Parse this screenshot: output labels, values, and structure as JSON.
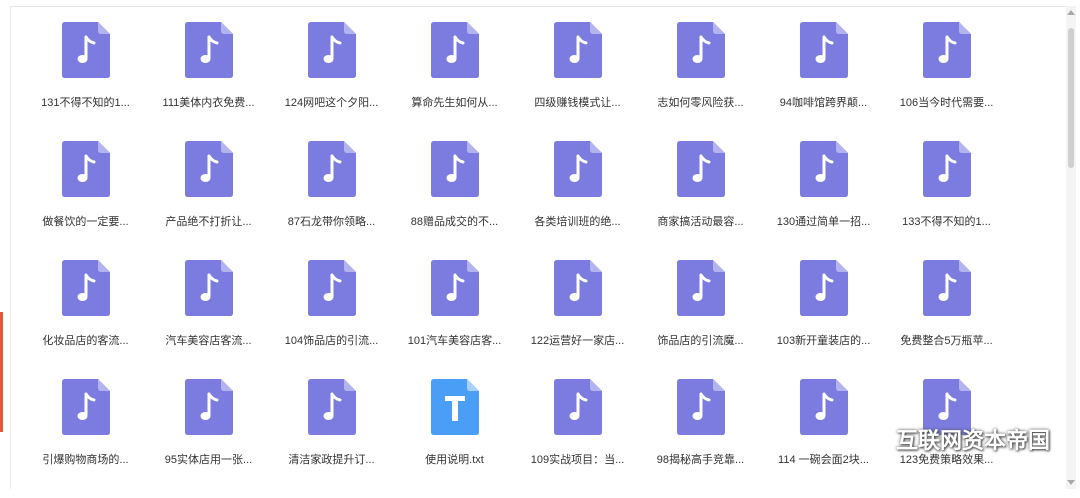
{
  "colors": {
    "audio_icon": "#7b7be0",
    "text_icon": "#4a9ef5",
    "fold": "#b3b3f0"
  },
  "files": [
    {
      "name": "131不得不知的1...",
      "type": "audio"
    },
    {
      "name": "111美体内衣免费...",
      "type": "audio"
    },
    {
      "name": "124网吧这个夕阳...",
      "type": "audio"
    },
    {
      "name": "算命先生如何从...",
      "type": "audio"
    },
    {
      "name": "四级赚钱模式让...",
      "type": "audio"
    },
    {
      "name": "志如何零风险获...",
      "type": "audio"
    },
    {
      "name": "94咖啡馆跨界颠...",
      "type": "audio"
    },
    {
      "name": "106当今时代需要...",
      "type": "audio"
    },
    {
      "name": "做餐饮的一定要...",
      "type": "audio"
    },
    {
      "name": "产品绝不打折让...",
      "type": "audio"
    },
    {
      "name": "87石龙带你领略...",
      "type": "audio"
    },
    {
      "name": "88赠品成交的不...",
      "type": "audio"
    },
    {
      "name": "各类培训班的绝...",
      "type": "audio"
    },
    {
      "name": "商家搞活动最容...",
      "type": "audio"
    },
    {
      "name": "130通过简单一招...",
      "type": "audio"
    },
    {
      "name": "133不得不知的1...",
      "type": "audio"
    },
    {
      "name": "化妆品店的客流...",
      "type": "audio"
    },
    {
      "name": "汽车美容店客流...",
      "type": "audio"
    },
    {
      "name": "104饰品店的引流...",
      "type": "audio"
    },
    {
      "name": "101汽车美容店客...",
      "type": "audio"
    },
    {
      "name": "122运营好一家店...",
      "type": "audio"
    },
    {
      "name": "饰品店的引流魔...",
      "type": "audio"
    },
    {
      "name": "103新开童装店的...",
      "type": "audio"
    },
    {
      "name": "免费整合5万瓶苹...",
      "type": "audio"
    },
    {
      "name": "引爆购物商场的...",
      "type": "audio"
    },
    {
      "name": "95实体店用一张...",
      "type": "audio"
    },
    {
      "name": "清洁家政提升订...",
      "type": "audio"
    },
    {
      "name": "使用说明.txt",
      "type": "text"
    },
    {
      "name": "109实战项目：当...",
      "type": "audio"
    },
    {
      "name": "98揭秘高手竞靠...",
      "type": "audio"
    },
    {
      "name": "114 一碗会面2块...",
      "type": "audio"
    },
    {
      "name": "123免费策略效果...",
      "type": "audio"
    }
  ],
  "watermark": {
    "text": "互联网资本帝国",
    "icon": "wechat-icon"
  }
}
